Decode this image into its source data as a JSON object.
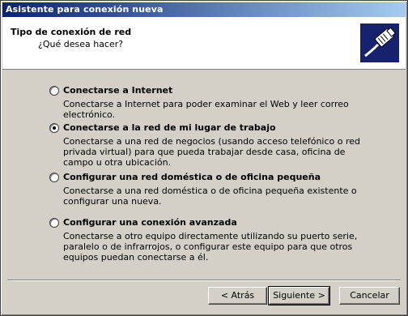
{
  "window": {
    "title": "Asistente para conexión nueva"
  },
  "header": {
    "title": "Tipo de conexión de red",
    "subtitle": "¿Qué desea hacer?",
    "icon": "network-cable-icon"
  },
  "options": [
    {
      "label": "Conectarse a Internet",
      "description": "Conectarse a Internet para poder examinar el Web y leer correo electrónico.",
      "selected": false
    },
    {
      "label": "Conectarse a la red de mi lugar de trabajo",
      "description": "Conectarse a una red de negocios (usando acceso telefónico o red privada virtual) para que pueda trabajar desde casa, oficina de campo u otra ubicación.",
      "selected": true
    },
    {
      "label": "Configurar una red doméstica o de oficina pequeña",
      "description": "Conectarse a una red doméstica o de oficina pequeña existente o configurar una nueva.",
      "selected": false
    },
    {
      "label": "Configurar una conexión avanzada",
      "description": "Conectarse a otro equipo directamente utilizando su puerto serie, paralelo o de infrarrojos, o configurar este equipo para que otros equipos puedan conectarse a él.",
      "selected": false
    }
  ],
  "buttons": {
    "back": "< Atrás",
    "next": "Siguiente >",
    "cancel": "Cancelar"
  }
}
